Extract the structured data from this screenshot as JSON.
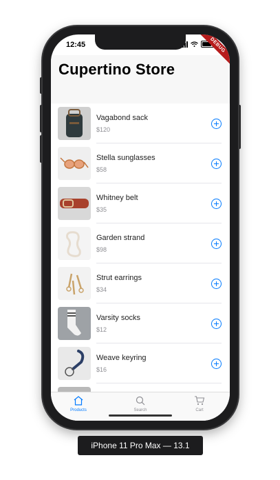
{
  "status_bar": {
    "time": "12:45",
    "debug_banner": "DEBUG"
  },
  "store": {
    "title": "Cupertino Store"
  },
  "products": [
    {
      "name": "Vagabond sack",
      "price": "$120",
      "thumb_color": "#2f3a3d"
    },
    {
      "name": "Stella sunglasses",
      "price": "$58",
      "thumb_color": "#d9b49c"
    },
    {
      "name": "Whitney belt",
      "price": "$35",
      "thumb_color": "#a8412c"
    },
    {
      "name": "Garden strand",
      "price": "$98",
      "thumb_color": "#e6dccf"
    },
    {
      "name": "Strut earrings",
      "price": "$34",
      "thumb_color": "#c9a36a"
    },
    {
      "name": "Varsity socks",
      "price": "$12",
      "thumb_color": "#9ea2a6"
    },
    {
      "name": "Weave keyring",
      "price": "$16",
      "thumb_color": "#2c3f66"
    }
  ],
  "tabs": [
    {
      "label": "Products",
      "icon": "home-icon",
      "active": true
    },
    {
      "label": "Search",
      "icon": "search-icon",
      "active": false
    },
    {
      "label": "Cart",
      "icon": "cart-icon",
      "active": false
    }
  ],
  "device": {
    "label": "iPhone 11 Pro Max — 13.1"
  },
  "colors": {
    "accent": "#007aff",
    "debug": "#b71c1c"
  }
}
